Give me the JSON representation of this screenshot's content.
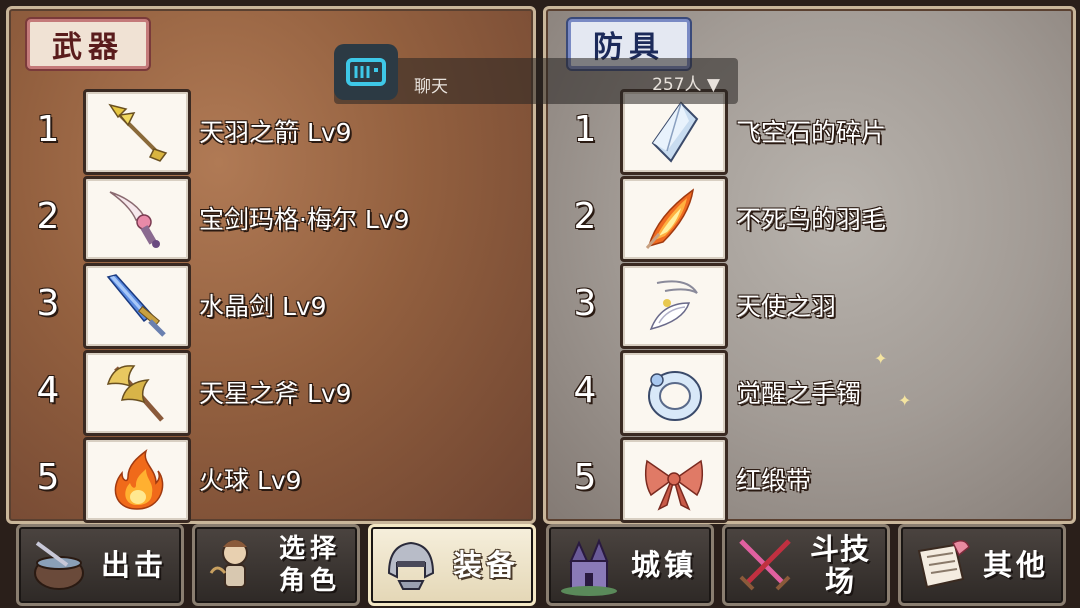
{
  "weapons": {
    "title": "武器",
    "items": [
      {
        "rank": "1",
        "name": "天羽之箭 Lv9",
        "icon": "feather-arrow-icon"
      },
      {
        "rank": "2",
        "name": "宝剑玛格·梅尔 Lv9",
        "icon": "pink-sword-icon"
      },
      {
        "rank": "3",
        "name": "水晶剑 Lv9",
        "icon": "crystal-sword-icon"
      },
      {
        "rank": "4",
        "name": "天星之斧 Lv9",
        "icon": "golden-axe-icon"
      },
      {
        "rank": "5",
        "name": "火球 Lv9",
        "icon": "fireball-icon"
      }
    ]
  },
  "armor": {
    "title": "防具",
    "items": [
      {
        "rank": "1",
        "name": "飞空石的碎片",
        "icon": "crystal-shard-icon"
      },
      {
        "rank": "2",
        "name": "不死鸟的羽毛",
        "icon": "phoenix-feather-icon"
      },
      {
        "rank": "3",
        "name": "天使之羽",
        "icon": "angel-feather-icon"
      },
      {
        "rank": "4",
        "name": "觉醒之手镯",
        "icon": "bracelet-icon"
      },
      {
        "rank": "5",
        "name": "红缎带",
        "icon": "red-ribbon-icon"
      }
    ]
  },
  "chat": {
    "label": "聊天",
    "count": "257人",
    "icon": "chat-logo-icon"
  },
  "nav": [
    {
      "label": "出击",
      "icon": "pot-icon",
      "active": false
    },
    {
      "label": "选择角色",
      "icon": "character-icon",
      "active": false
    },
    {
      "label": "装备",
      "icon": "helmet-icon",
      "active": true
    },
    {
      "label": "城镇",
      "icon": "castle-icon",
      "active": false
    },
    {
      "label": "斗技场",
      "icon": "crossed-swords-icon",
      "active": false
    },
    {
      "label": "其他",
      "icon": "scroll-icon",
      "active": false
    }
  ]
}
